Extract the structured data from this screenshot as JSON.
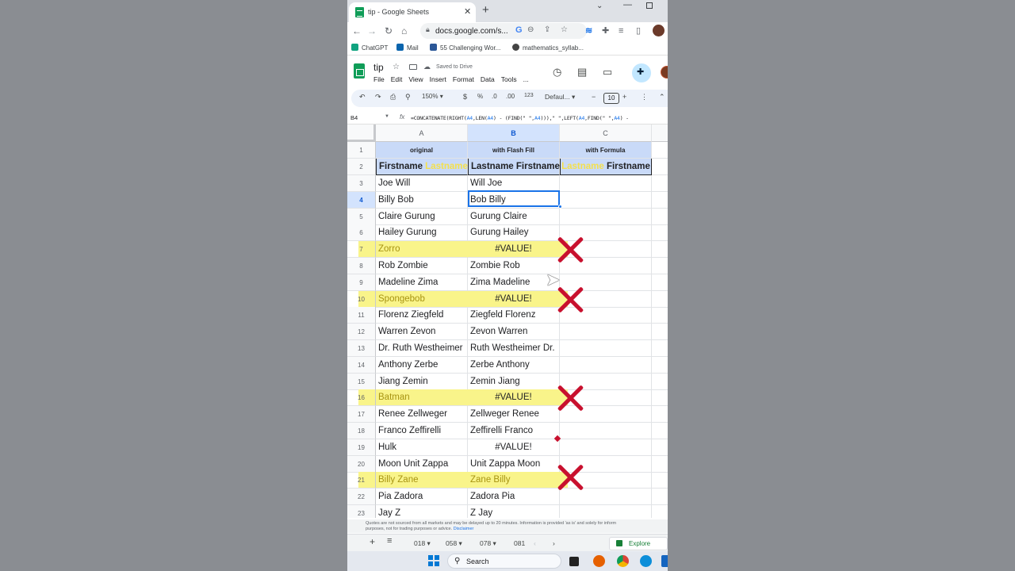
{
  "browser": {
    "tab_title": "tip - Google Sheets",
    "tab_close": "✕",
    "new_tab": "+",
    "url": "docs.google.com/s...",
    "nav": {
      "back": "←",
      "forward": "→",
      "reload": "↻",
      "home": "⌂"
    },
    "bookmarks": [
      {
        "label": "ChatGPT",
        "color": "#10a37f"
      },
      {
        "label": "Mail",
        "color": "#0a64ad"
      },
      {
        "label": "55 Challenging Wor...",
        "color": "#2b5797"
      },
      {
        "label": "mathematics_syllab...",
        "color": "#444"
      }
    ]
  },
  "sheets": {
    "doc_title": "tip",
    "saved_status": "Saved to Drive",
    "menu": [
      "File",
      "Edit",
      "View",
      "Insert",
      "Format",
      "Data",
      "Tools",
      "..."
    ],
    "toolbar": {
      "zoom": "150%",
      "currency": "$",
      "percent": "%",
      "dec_decrease": ".0",
      "dec_increase": ".00",
      "number_format": "123",
      "font": "Defaul...",
      "font_size": "10",
      "minus": "−",
      "plus": "+"
    },
    "name_box": "B4",
    "fx": "fx",
    "formula_parts": {
      "p1": "=CONCATENATE(RIGHT(",
      "r1": "A4",
      "p2": ",LEN(",
      "r2": "A4",
      "p3": ") - (FIND(\" \",",
      "r3": "A4",
      "p4": "))),\" \",LEFT(",
      "r4": "A4",
      "p5": ",FIND(\" \",",
      "r5": "A4",
      "p6": ") -"
    },
    "columns": [
      "A",
      "B",
      "C"
    ],
    "selected_cell": "B4"
  },
  "table": {
    "row1": {
      "num": "1",
      "a": "original",
      "b": "with Flash Fill",
      "c": "with Formula"
    },
    "row2": {
      "num": "2",
      "a_first": "Firstname",
      "a_last": "Lastname",
      "b": "Lastname Firstname",
      "c_last": "Lastname",
      "c_first": "Firstname"
    },
    "rows": [
      {
        "num": "3",
        "a": "Joe Will",
        "b": "Will Joe"
      },
      {
        "num": "4",
        "a": "Billy Bob",
        "b": "Bob Billy"
      },
      {
        "num": "5",
        "a": "Claire Gurung",
        "b": "Gurung Claire"
      },
      {
        "num": "6",
        "a": "Hailey Gurung",
        "b": "Gurung Hailey"
      },
      {
        "num": "7",
        "a": "Zorro",
        "b": "#VALUE!"
      },
      {
        "num": "8",
        "a": "Rob Zombie",
        "b": "Zombie Rob"
      },
      {
        "num": "9",
        "a": "Madeline Zima",
        "b": "Zima Madeline"
      },
      {
        "num": "10",
        "a": "Spongebob",
        "b": "#VALUE!"
      },
      {
        "num": "11",
        "a": "Florenz Ziegfeld",
        "b": "Ziegfeld Florenz"
      },
      {
        "num": "12",
        "a": "Warren Zevon",
        "b": "Zevon Warren"
      },
      {
        "num": "13",
        "a": "Dr. Ruth Westheimer",
        "b": "Ruth Westheimer Dr."
      },
      {
        "num": "14",
        "a": "Anthony Zerbe",
        "b": "Zerbe Anthony"
      },
      {
        "num": "15",
        "a": "Jiang Zemin",
        "b": "Zemin Jiang"
      },
      {
        "num": "16",
        "a": "Batman",
        "b": "#VALUE!"
      },
      {
        "num": "17",
        "a": "Renee Zellweger",
        "b": "Zellweger Renee"
      },
      {
        "num": "18",
        "a": "Franco Zeffirelli",
        "b": "Zeffirelli Franco"
      },
      {
        "num": "19",
        "a": "Hulk",
        "b": "#VALUE!"
      },
      {
        "num": "20",
        "a": "Moon Unit Zappa",
        "b": "Unit Zappa Moon"
      },
      {
        "num": "21",
        "a": "Billy Zane",
        "b": "Zane Billy"
      },
      {
        "num": "22",
        "a": "Pia Zadora",
        "b": "Zadora Pia"
      },
      {
        "num": "23",
        "a": "Jay Z",
        "b": "Z Jay"
      }
    ]
  },
  "footer": {
    "disclaimer_line1": "Quotes are not sourced from all markets and may be delayed up to 20 minutes. Information is provided 'as is' and solely for inform",
    "disclaimer_line2": "purposes, not for trading purposes or advice.",
    "disclaimer_link": "Disclaimer",
    "add_sheet": "+",
    "all_sheets": "≡",
    "sheet_tabs": [
      "018",
      "058",
      "078",
      "081"
    ],
    "explore": "Explore"
  },
  "taskbar": {
    "search": "Search"
  }
}
